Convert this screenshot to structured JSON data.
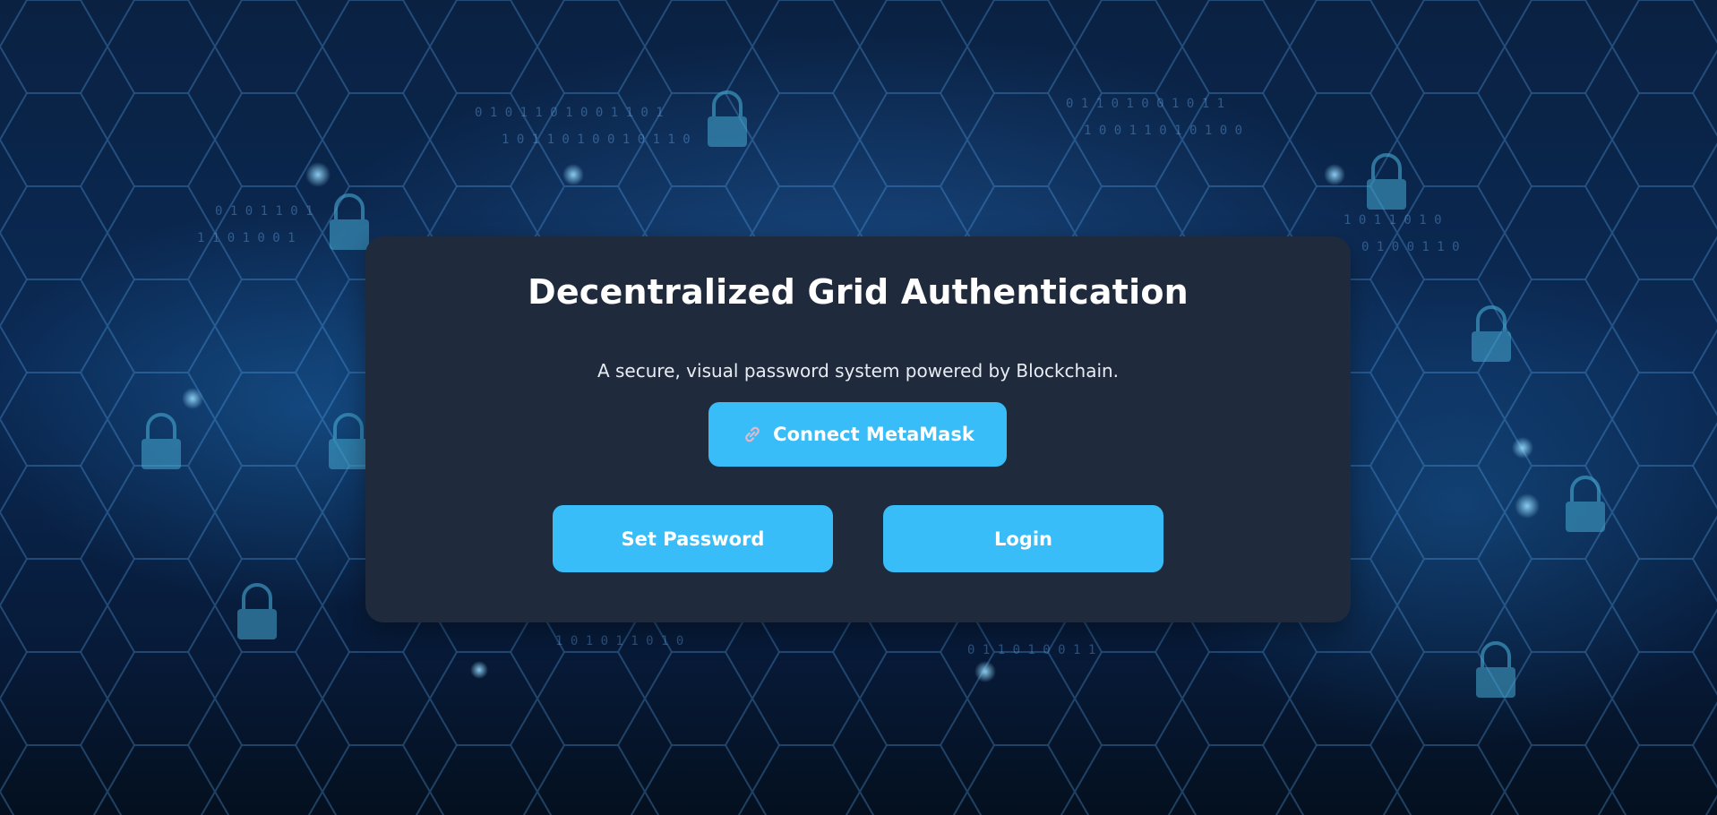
{
  "auth_card": {
    "title": "Decentralized Grid Authentication",
    "subtitle": "A secure, visual password system powered by Blockchain."
  },
  "actions": {
    "connect_label": "Connect MetaMask",
    "connect_icon": "link-icon",
    "set_password_label": "Set Password",
    "login_label": "Login"
  },
  "theme": {
    "card_bg": "#1f2a3c",
    "accent": "#38bdf8",
    "text": "#ffffff"
  },
  "background": {
    "description_icons": [
      "hexagon-grid",
      "padlock-icon",
      "binary-digits"
    ]
  }
}
